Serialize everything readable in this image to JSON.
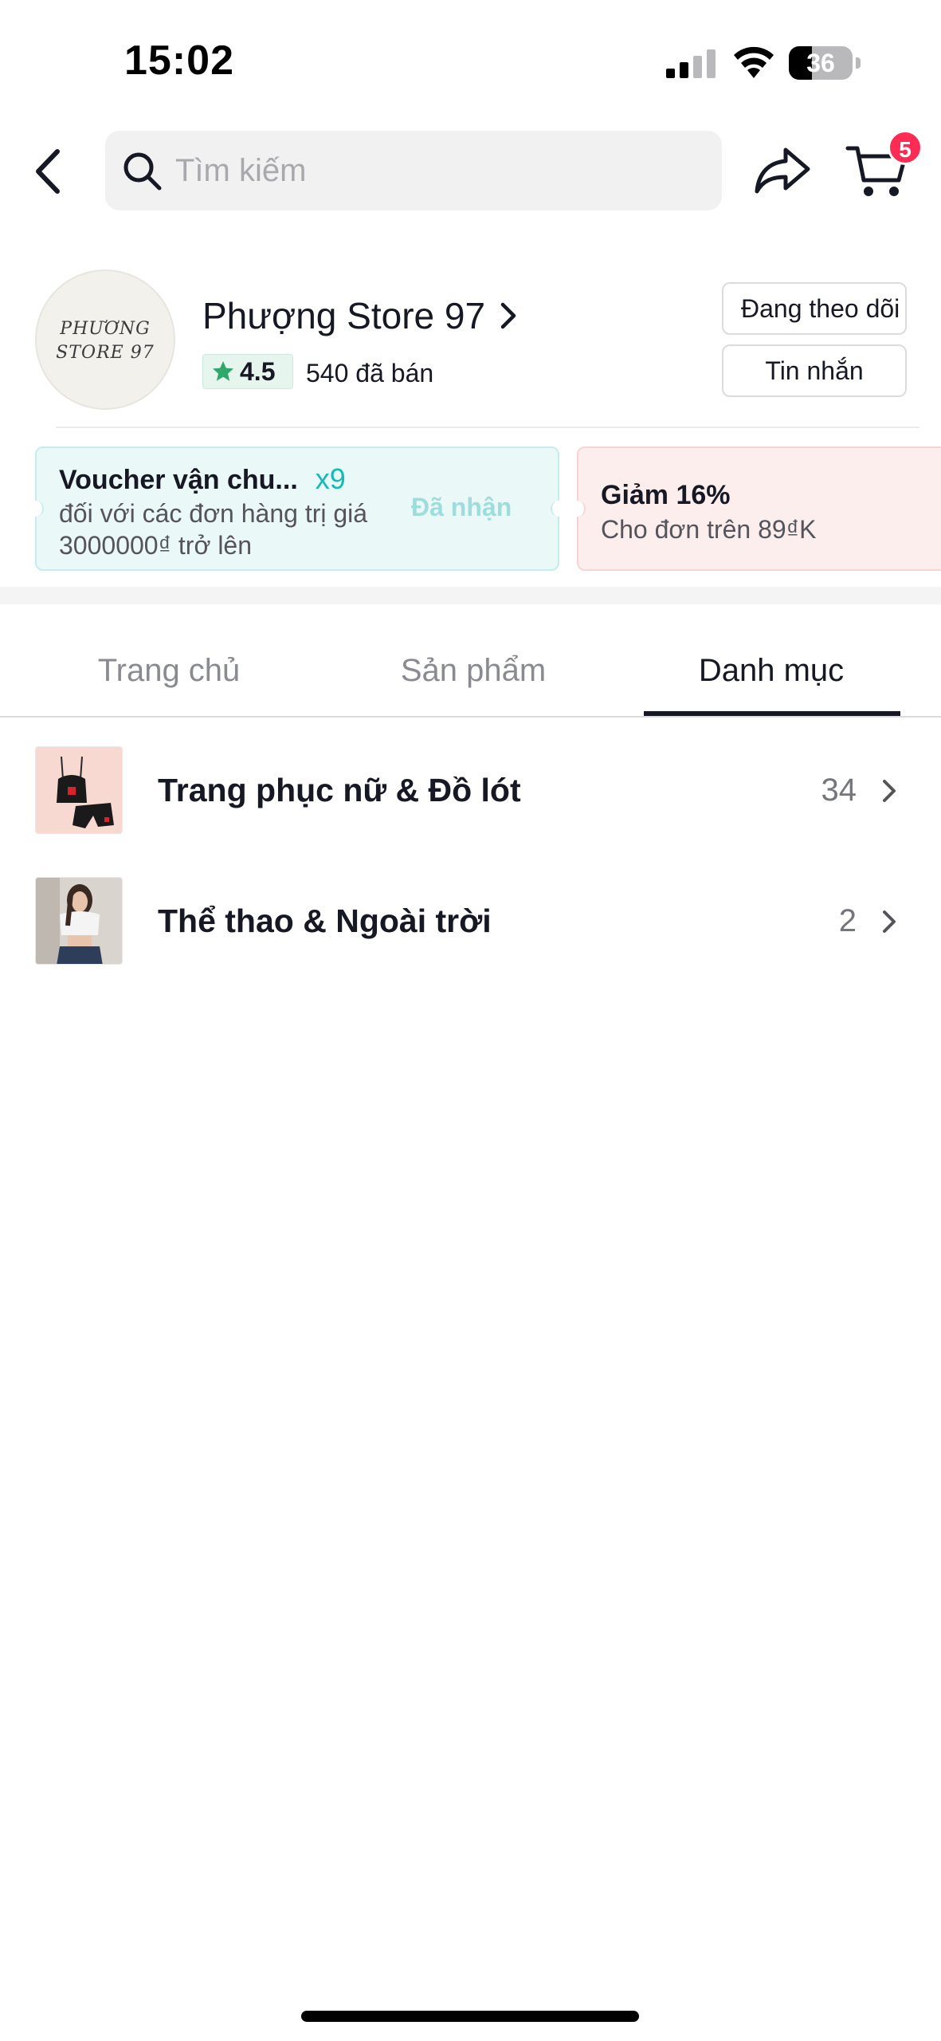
{
  "status_bar": {
    "time": "15:02",
    "battery": "36",
    "battery_level": 0.36
  },
  "search": {
    "placeholder": "Tìm kiếm"
  },
  "cart": {
    "badge_count": "5"
  },
  "store": {
    "logo_line1": "PHƯƠNG",
    "logo_line2": "STORE 97",
    "name": "Phượng Store 97",
    "rating": "4.5",
    "sold": "540 đã bán",
    "follow_label": "Đang theo dõi",
    "message_label": "Tin nhắn"
  },
  "vouchers": [
    {
      "title": "Voucher vận chu...",
      "count": "x9",
      "description": "đối với các đơn hàng trị giá 3000000₫ trở lên",
      "status": "Đã nhận"
    },
    {
      "title": "Giảm 16%",
      "description": "Cho đơn trên 89₫K"
    }
  ],
  "tabs": [
    {
      "label": "Trang chủ",
      "active": false
    },
    {
      "label": "Sản phẩm",
      "active": false
    },
    {
      "label": "Danh mục",
      "active": true
    }
  ],
  "categories": [
    {
      "name": "Trang phục nữ & Đồ lót",
      "count": "34"
    },
    {
      "name": "Thể thao & Ngoài trời",
      "count": "2"
    }
  ],
  "colors": {
    "accent_badge": "#fe2c55",
    "rating_star": "#2fa869",
    "voucher_count": "#17b8b8",
    "voucher_bg_teal": "#eaf8f8",
    "voucher_bg_pink": "#fdeeee"
  }
}
